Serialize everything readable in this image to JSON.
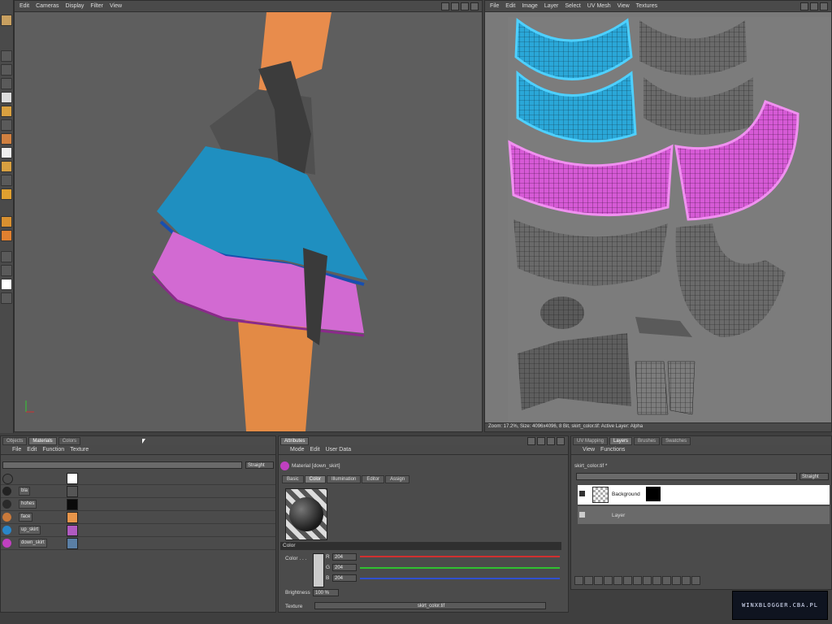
{
  "viewport": {
    "menu": [
      "Edit",
      "Cameras",
      "Display",
      "Filter",
      "View"
    ]
  },
  "uv_view": {
    "menu": [
      "File",
      "Edit",
      "Image",
      "Layer",
      "Select",
      "UV Mesh",
      "View",
      "Textures"
    ],
    "status": "Zoom: 17.2%, Size: 4096x4096, 8 Bit, skirt_color.tif: Active Layer: Alpha"
  },
  "materials_panel": {
    "tabs": [
      "Objects",
      "Materials",
      "Colors"
    ],
    "active_tab": "Materials",
    "menu": [
      "File",
      "Edit",
      "Function",
      "Texture"
    ],
    "filter": "Straight",
    "materials": [
      {
        "name": "",
        "ball": "#222222",
        "swatch": "#ffffff"
      },
      {
        "name": "bla",
        "ball": "#333333",
        "swatch": "#555555"
      },
      {
        "name": "hohes",
        "ball": "#2a2a2a",
        "swatch": "#0a0a0a"
      },
      {
        "name": "face",
        "ball": "#c9793a",
        "swatch": "#e8954a"
      },
      {
        "name": "up_skirt",
        "ball": "#2a86c9",
        "swatch": "#b05ac0"
      },
      {
        "name": "down_skirt",
        "ball": "#c040c0",
        "swatch": "#5a7fa5"
      }
    ]
  },
  "attributes_panel": {
    "tab": "Attributes",
    "menu": [
      "Mode",
      "Edit",
      "User Data"
    ],
    "material_title": "Material [down_skirt]",
    "subtabs": [
      "Basic",
      "Color",
      "Illumination",
      "Editor",
      "Assign"
    ],
    "active_subtab": "Color",
    "section": "Color",
    "color_label": "Color . . .",
    "channels": [
      {
        "name": "R",
        "value": "204",
        "color": "#d03030"
      },
      {
        "name": "G",
        "value": "204",
        "color": "#30c030"
      },
      {
        "name": "B",
        "value": "204",
        "color": "#3050d0"
      }
    ],
    "brightness_label": "Brightness",
    "brightness_value": "100 %",
    "texture_label": "Texture",
    "texture_value": "skirt_color.tif"
  },
  "layers_panel": {
    "tabs": [
      "UV Mapping",
      "Layers",
      "Brushes",
      "Swatches"
    ],
    "active_tab": "Layers",
    "menu": [
      "View",
      "Functions"
    ],
    "file": "skirt_color.tif *",
    "blend": "Straight",
    "layers": [
      {
        "name": "Background"
      },
      {
        "name": "Layer"
      }
    ]
  },
  "watermark": "WINXBLOGGER.CBA.PL"
}
